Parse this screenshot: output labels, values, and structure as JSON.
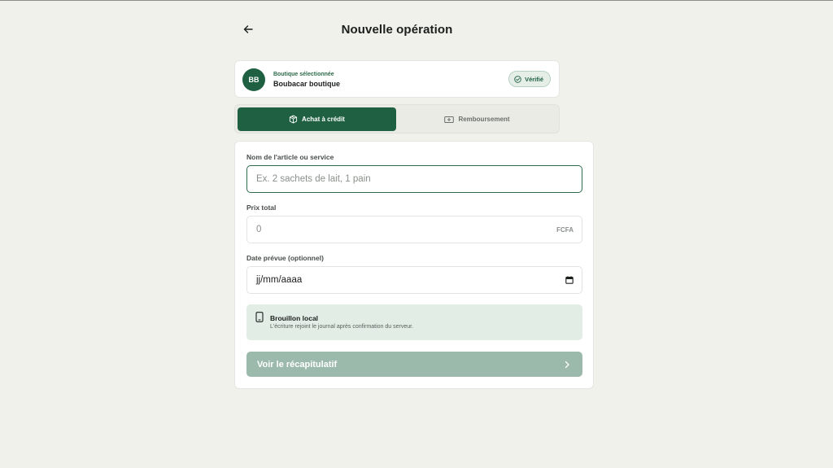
{
  "header": {
    "title": "Nouvelle opération",
    "back_icon": "arrow-left-icon"
  },
  "shop": {
    "initials": "BB",
    "subtitle": "Boutique sélectionnée",
    "name": "Boubacar boutique",
    "badge": "Vérifié",
    "badge_icon": "check-circle-icon"
  },
  "tabs": [
    {
      "label": "Achat à crédit",
      "icon": "package-icon",
      "active": true
    },
    {
      "label": "Remboursement",
      "icon": "banknote-icon",
      "active": false
    }
  ],
  "form": {
    "item": {
      "label": "Nom de l'article ou service",
      "value": "",
      "placeholder": "Ex. 2 sachets de lait, 1 pain"
    },
    "price": {
      "label": "Prix total",
      "value": "",
      "placeholder": "0",
      "suffix": "FCFA"
    },
    "date": {
      "label": "Date prévue (optionnel)",
      "value": "jj/mm/aaaa",
      "icon": "calendar-icon"
    }
  },
  "draft": {
    "icon": "phone-icon",
    "title": "Brouillon local",
    "description": "L'écriture rejoint le journal après confirmation du serveur."
  },
  "submit": {
    "label": "Voir le récapitulatif",
    "icon": "chevron-right-icon"
  },
  "colors": {
    "brand": "#1f6042",
    "background": "#f1f1ec",
    "disabled_button": "#9cbaab",
    "draft_background": "#e1ede5"
  }
}
